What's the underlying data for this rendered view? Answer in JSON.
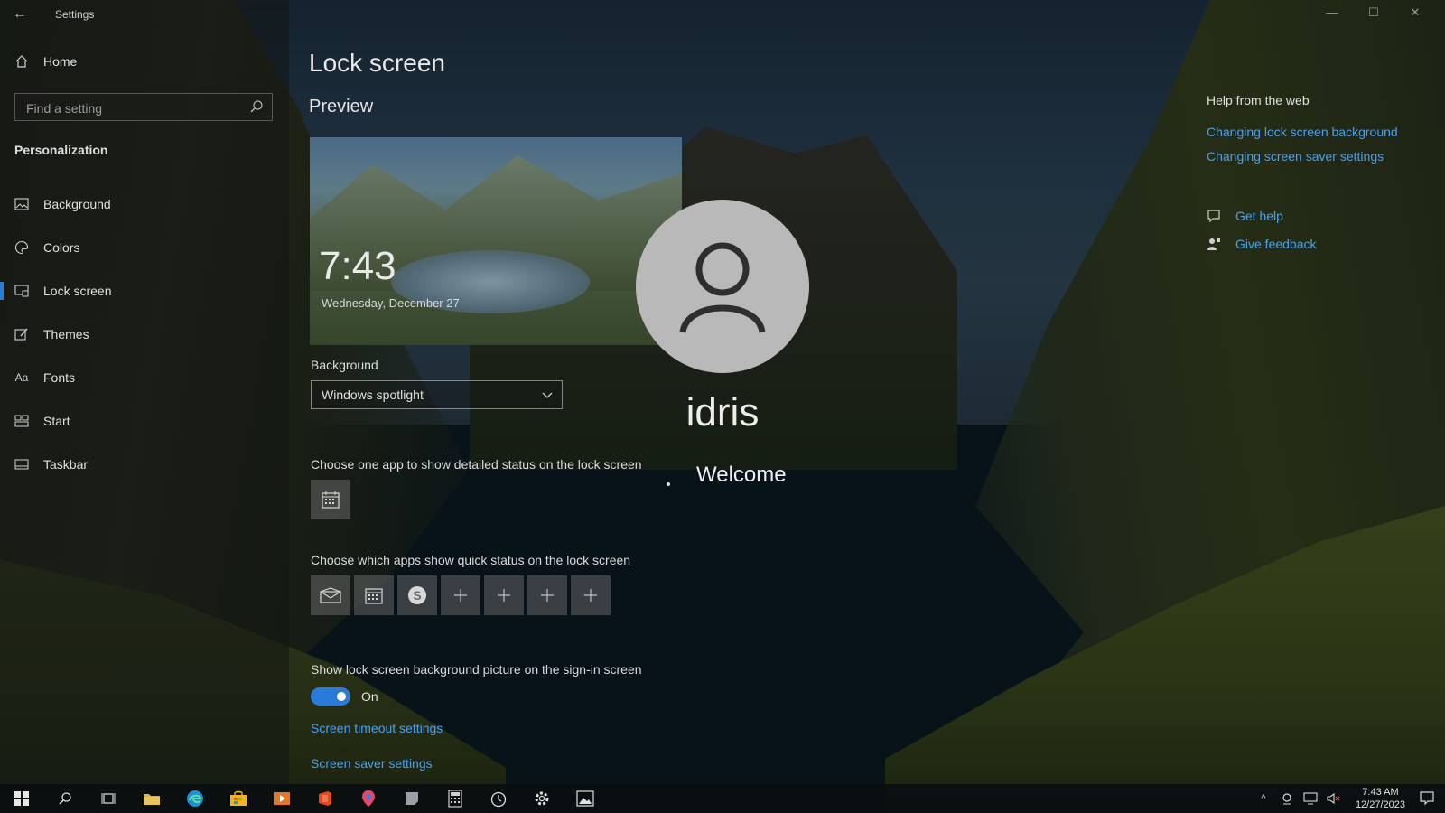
{
  "window": {
    "title": "Settings",
    "controls": {
      "minimize": "—",
      "maximize": "☐",
      "close": "✕"
    }
  },
  "sidebar": {
    "home_label": "Home",
    "search_placeholder": "Find a setting",
    "section": "Personalization",
    "items": [
      {
        "label": "Background",
        "icon": "image-icon"
      },
      {
        "label": "Colors",
        "icon": "palette-icon"
      },
      {
        "label": "Lock screen",
        "icon": "lock-screen-icon",
        "active": true
      },
      {
        "label": "Themes",
        "icon": "brush-icon"
      },
      {
        "label": "Fonts",
        "icon": "font-icon"
      },
      {
        "label": "Start",
        "icon": "start-icon"
      },
      {
        "label": "Taskbar",
        "icon": "taskbar-icon"
      }
    ]
  },
  "main": {
    "title": "Lock screen",
    "preview_label": "Preview",
    "preview_time": "7:43",
    "preview_date": "Wednesday, December 27",
    "background_label": "Background",
    "background_value": "Windows spotlight",
    "detailed_status_label": "Choose one app to show detailed status on the lock screen",
    "quick_status_label": "Choose which apps show quick status on the lock screen",
    "signin_label": "Show lock screen background picture on the sign-in screen",
    "signin_toggle_state": "On",
    "timeout_link": "Screen timeout settings",
    "screensaver_link": "Screen saver settings"
  },
  "help": {
    "title": "Help from the web",
    "links": [
      "Changing lock screen background",
      "Changing screen saver settings"
    ],
    "get_help": "Get help",
    "give_feedback": "Give feedback"
  },
  "overlay": {
    "username": "idris",
    "welcome": "Welcome"
  },
  "taskbar": {
    "time": "7:43 AM",
    "date": "12/27/2023"
  },
  "colors": {
    "accent": "#2b7ad8",
    "link": "#4aa0f0"
  }
}
